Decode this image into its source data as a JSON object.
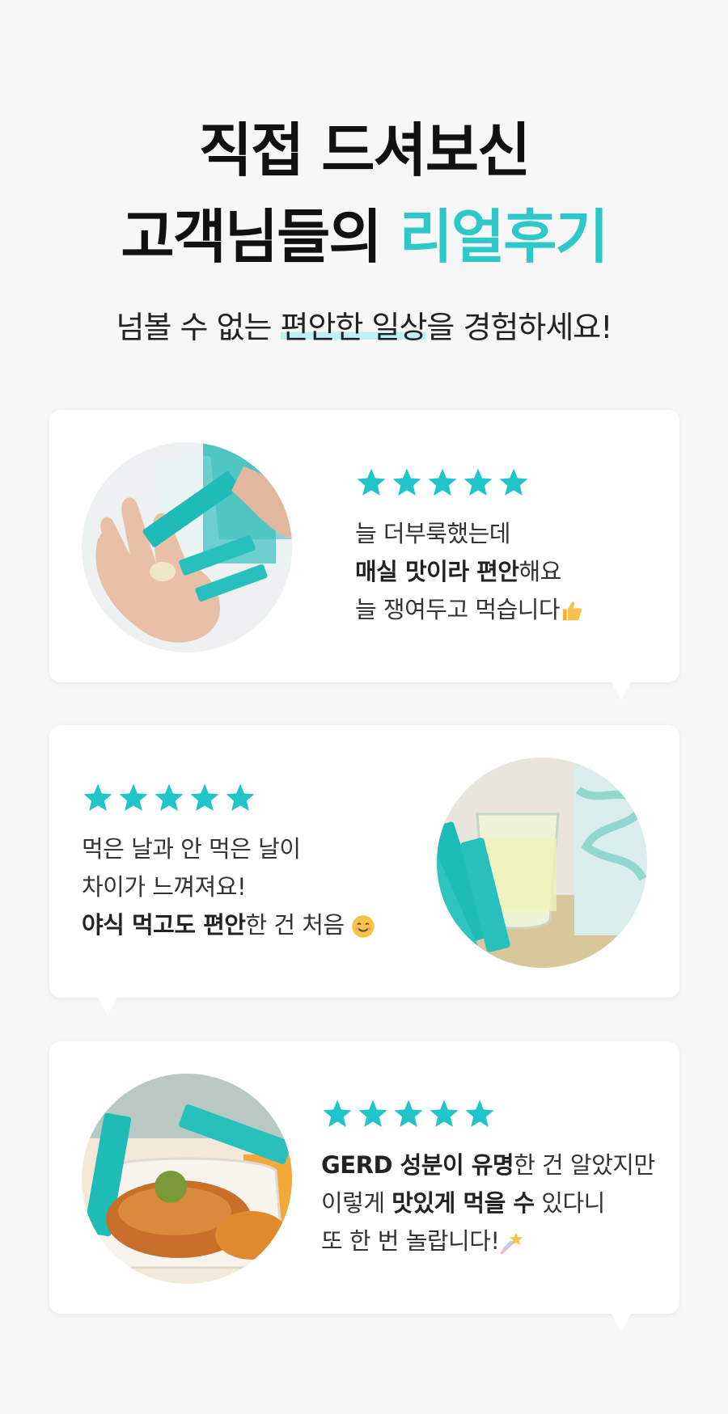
{
  "hero": {
    "title_line1": "직접 드셔보신",
    "title_line2_plain": "고객님들의 ",
    "title_line2_accent": "리얼후기",
    "subtitle_pre": "넘볼 수 없는 ",
    "subtitle_highlight": "편안한 일상",
    "subtitle_post": "을 경험하세요!"
  },
  "colors": {
    "accent": "#2ec8c8",
    "star": "#1fc5c9",
    "background": "#f7f7f7"
  },
  "reviews": [
    {
      "stars": 5,
      "lines": [
        {
          "parts": [
            {
              "text": "늘 더부룩했는데",
              "bold": false
            }
          ]
        },
        {
          "parts": [
            {
              "text": "매실 맛이라 편안",
              "bold": true
            },
            {
              "text": "해요",
              "bold": false
            }
          ]
        },
        {
          "parts": [
            {
              "text": "늘 쟁여두고 먹습니다",
              "bold": false
            }
          ],
          "emoji": "thumbs-up-icon"
        }
      ]
    },
    {
      "stars": 5,
      "lines": [
        {
          "parts": [
            {
              "text": "먹은 날과 안 먹은 날이",
              "bold": false
            }
          ]
        },
        {
          "parts": [
            {
              "text": "차이가 느껴져요!",
              "bold": false
            }
          ]
        },
        {
          "parts": [
            {
              "text": "야식 먹고도 편안",
              "bold": true
            },
            {
              "text": "한 건 처음 ",
              "bold": false
            }
          ],
          "emoji": "smiling-face-icon"
        }
      ]
    },
    {
      "stars": 5,
      "lines": [
        {
          "parts": [
            {
              "text": "GERD 성분이 유명",
              "bold": true
            },
            {
              "text": "한 건 알았지만",
              "bold": false
            }
          ]
        },
        {
          "parts": [
            {
              "text": "이렇게 ",
              "bold": false
            },
            {
              "text": "맛있게 먹을 수",
              "bold": true
            },
            {
              "text": " 있다니",
              "bold": false
            }
          ]
        },
        {
          "parts": [
            {
              "text": "또 한 번 놀랍니다!",
              "bold": false
            }
          ],
          "emoji": "shooting-star-icon"
        }
      ]
    }
  ]
}
